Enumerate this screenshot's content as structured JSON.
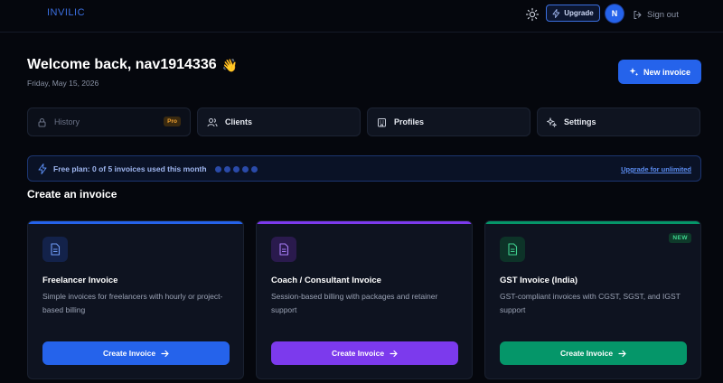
{
  "app": {
    "logo": "INVILIC"
  },
  "header": {
    "upgrade_label": "Upgrade",
    "avatar_initial": "N",
    "signout_label": "Sign out"
  },
  "welcome": {
    "title": "Welcome back, nav1914336",
    "emoji": "👋",
    "date": "Friday, May 15, 2026",
    "new_invoice_label": "New invoice"
  },
  "nav": {
    "tabs": [
      {
        "label": "History",
        "badge": "Pro",
        "icon": "lock-icon"
      },
      {
        "label": "Clients",
        "icon": "users-icon"
      },
      {
        "label": "Profiles",
        "icon": "building-icon"
      },
      {
        "label": "Settings",
        "icon": "sparkles-icon"
      }
    ]
  },
  "plan": {
    "text": "Free plan: 0 of 5 invoices used this month",
    "used": 0,
    "limit": 5,
    "upgrade_link": "Upgrade for unlimited"
  },
  "section": {
    "title": "Create an invoice"
  },
  "cards": [
    {
      "title": "Freelancer Invoice",
      "description": "Simple invoices for freelancers with hourly or project-based billing",
      "button": "Create Invoice",
      "accent": "#2563eb"
    },
    {
      "title": "Coach / Consultant Invoice",
      "description": "Session-based billing with packages and retainer support",
      "button": "Create Invoice",
      "accent": "#7c3aed"
    },
    {
      "title": "GST Invoice (India)",
      "description": "GST-compliant invoices with CGST, SGST, and IGST support",
      "button": "Create Invoice",
      "badge": "NEW",
      "accent": "#059669"
    }
  ]
}
